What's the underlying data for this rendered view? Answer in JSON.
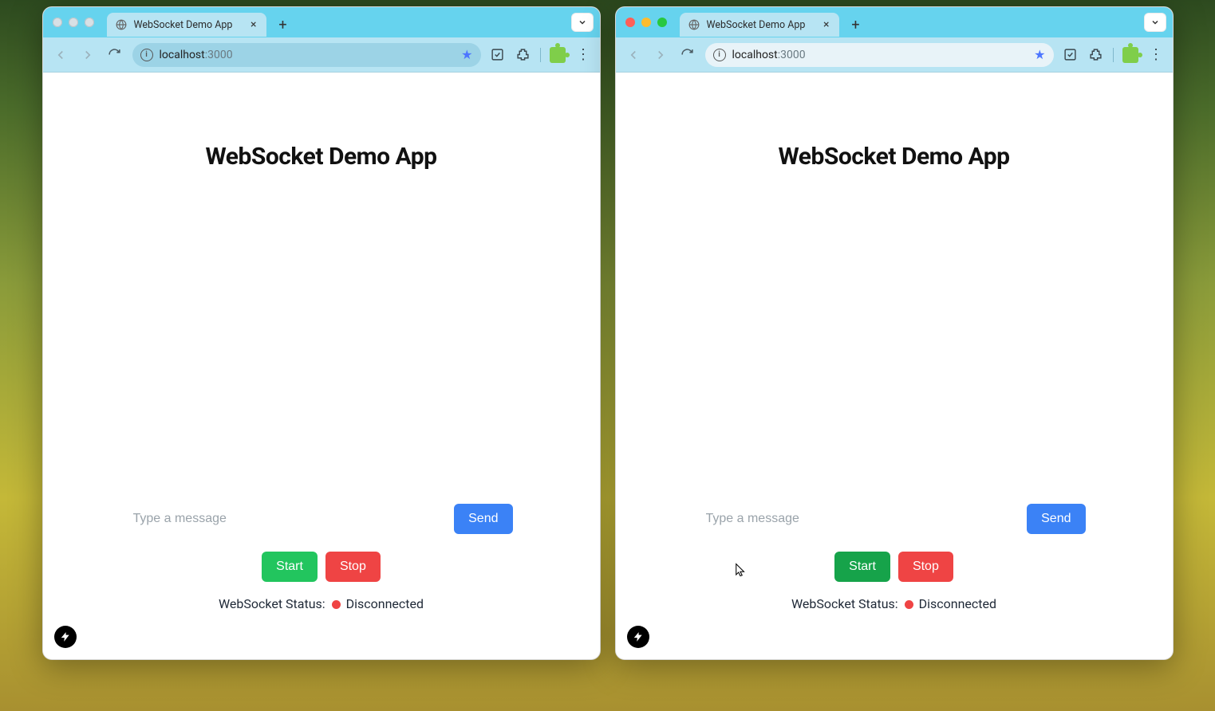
{
  "windows": [
    {
      "id": "left",
      "traffic_style": "gray",
      "tab": {
        "title": "WebSocket Demo App",
        "favicon": "globe"
      },
      "url_host": "localhost",
      "url_port": ":3000",
      "page": {
        "heading": "WebSocket Demo App",
        "compose_placeholder": "Type a message",
        "send_label": "Send",
        "start_label": "Start",
        "stop_label": "Stop",
        "start_pressed": false,
        "status_label": "WebSocket Status:",
        "status_value": "Disconnected",
        "status_color": "red"
      }
    },
    {
      "id": "right",
      "traffic_style": "color",
      "tab": {
        "title": "WebSocket Demo App",
        "favicon": "globe"
      },
      "url_host": "localhost",
      "url_port": ":3000",
      "page": {
        "heading": "WebSocket Demo App",
        "compose_placeholder": "Type a message",
        "send_label": "Send",
        "start_label": "Start",
        "stop_label": "Stop",
        "start_pressed": true,
        "status_label": "WebSocket Status:",
        "status_value": "Disconnected",
        "status_color": "red"
      }
    }
  ]
}
